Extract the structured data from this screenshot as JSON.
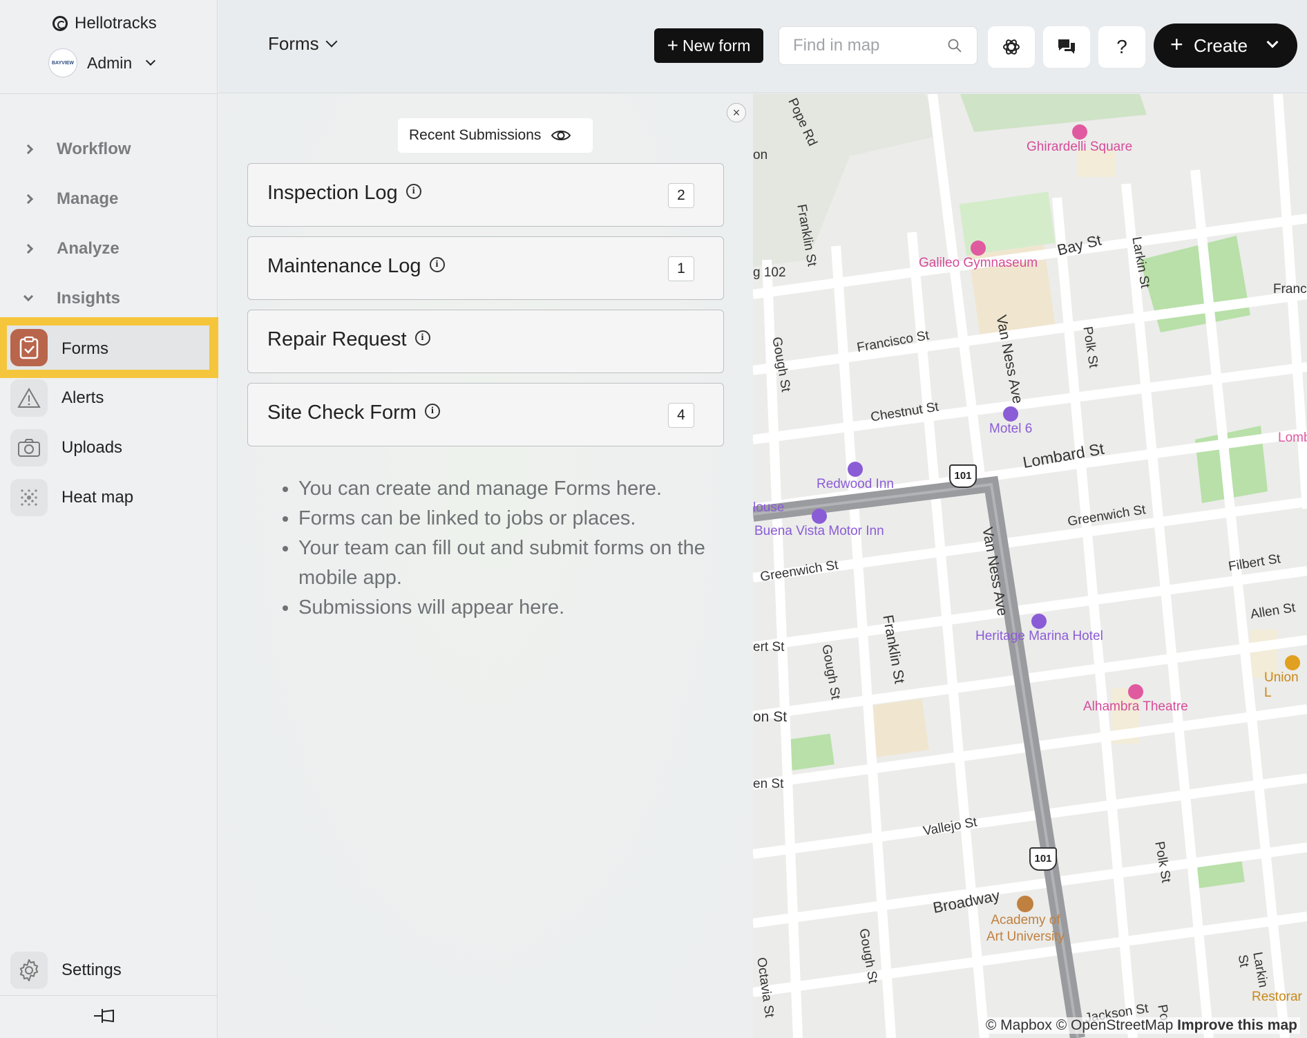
{
  "app": {
    "name": "Hellotracks",
    "account_name": "Admin",
    "avatar_text": "BAYVIEW"
  },
  "sidebar": {
    "sections": [
      {
        "label": "Workflow",
        "expanded": false
      },
      {
        "label": "Manage",
        "expanded": false
      },
      {
        "label": "Analyze",
        "expanded": false
      },
      {
        "label": "Insights",
        "expanded": true
      }
    ],
    "items": [
      {
        "label": "Forms",
        "icon": "clipboard-check-icon",
        "active": true
      },
      {
        "label": "Alerts",
        "icon": "warning-icon",
        "active": false
      },
      {
        "label": "Uploads",
        "icon": "camera-icon",
        "active": false
      },
      {
        "label": "Heat map",
        "icon": "heatmap-dots-icon",
        "active": false
      }
    ],
    "settings_label": "Settings"
  },
  "header": {
    "title": "Forms",
    "new_form_label": "New form",
    "search_placeholder": "Find in map",
    "create_label": "Create"
  },
  "panel": {
    "recent_label": "Recent Submissions",
    "forms": [
      {
        "name": "Inspection Log",
        "count": "2"
      },
      {
        "name": "Maintenance Log",
        "count": "1"
      },
      {
        "name": "Repair Request",
        "count": ""
      },
      {
        "name": "Site Check Form",
        "count": "4"
      }
    ],
    "bullets": [
      "You can create and manage Forms here.",
      "Forms can be linked to jobs or places.",
      "Your team can fill out and submit forms on the mobile app.",
      "Submissions will appear here."
    ]
  },
  "map": {
    "streets": [
      {
        "name": "Pope Rd"
      },
      {
        "name": "Franklin St"
      },
      {
        "name": "Bay St"
      },
      {
        "name": "Larkin St"
      },
      {
        "name": "Francisco St"
      },
      {
        "name": "Van Ness Ave"
      },
      {
        "name": "Polk St"
      },
      {
        "name": "Gough St"
      },
      {
        "name": "Chestnut St"
      },
      {
        "name": "Lombard St"
      },
      {
        "name": "Greenwich St"
      },
      {
        "name": "Filbert St"
      },
      {
        "name": "Allen St"
      },
      {
        "name": "Vallejo St"
      },
      {
        "name": "Broadway"
      },
      {
        "name": "Octavia St"
      },
      {
        "name": "Jackson St"
      },
      {
        "name": "ert St"
      },
      {
        "name": "on St"
      },
      {
        "name": "en St"
      },
      {
        "name": "Francis"
      },
      {
        "name": "Lomb"
      },
      {
        "name": "on"
      },
      {
        "name": "g 102"
      },
      {
        "name": "Po"
      }
    ],
    "pois": [
      {
        "name": "Ghirardelli Square",
        "color": "#d64b9a"
      },
      {
        "name": "Galileo Gymnaseum",
        "color": "#d64b9a"
      },
      {
        "name": "Motel 6",
        "color": "#8a5cd6"
      },
      {
        "name": "Redwood Inn",
        "color": "#8a5cd6"
      },
      {
        "name": "Buena Vista Motor Inn",
        "color": "#8a5cd6"
      },
      {
        "name": "Heritage Marina Hotel",
        "color": "#8a5cd6"
      },
      {
        "name": "Alhambra Theatre",
        "color": "#d64b9a"
      },
      {
        "name": "Academy of",
        "color": "#c08040"
      },
      {
        "name": "Art University",
        "color": "#c08040"
      },
      {
        "name": "Union L",
        "color": "#e0a020"
      },
      {
        "name": "Restorar",
        "color": "#e0a020"
      },
      {
        "name": "louse",
        "color": "#8a5cd6"
      }
    ],
    "shields": [
      "101",
      "101"
    ],
    "attribution_text": "© Mapbox © OpenStreetMap",
    "improve_label": "Improve this map"
  },
  "colors": {
    "active_highlight": "#f5c63c",
    "forms_icon_bg": "#b8654c",
    "primary_button": "#111111"
  }
}
